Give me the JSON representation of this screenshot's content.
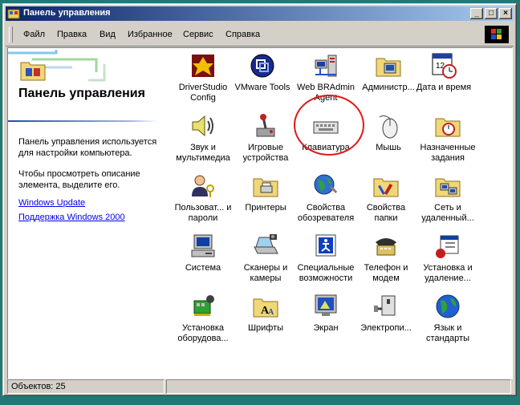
{
  "window": {
    "title": "Панель управления"
  },
  "menu": [
    "Файл",
    "Правка",
    "Вид",
    "Избранное",
    "Сервис",
    "Справка"
  ],
  "sidebar": {
    "heading": "Панель управления",
    "desc1": "Панель управления используется для настройки компьютера.",
    "desc2": "Чтобы просмотреть описание элемента, выделите его.",
    "links": [
      "Windows Update",
      "Поддержка Windows 2000"
    ]
  },
  "icons": [
    {
      "label": "DriverStudio Config",
      "icon": "driverstudio-icon"
    },
    {
      "label": "VMware Tools",
      "icon": "vmware-icon"
    },
    {
      "label": "Web BRAdmin Agent",
      "icon": "network-agent-icon"
    },
    {
      "label": "Админиcтр...",
      "icon": "admin-tools-icon"
    },
    {
      "label": "Дата и время",
      "icon": "calendar-clock-icon"
    },
    {
      "label": "Звук и мультимедиа",
      "icon": "speaker-icon"
    },
    {
      "label": "Игровые устройства",
      "icon": "joystick-icon"
    },
    {
      "label": "Клавиатура",
      "icon": "keyboard-icon"
    },
    {
      "label": "Мышь",
      "icon": "mouse-icon"
    },
    {
      "label": "Назначенные задания",
      "icon": "scheduled-tasks-icon"
    },
    {
      "label": "Пользоват... и пароли",
      "icon": "users-icon"
    },
    {
      "label": "Принтеры",
      "icon": "printer-folder-icon"
    },
    {
      "label": "Свойства обозревателя",
      "icon": "globe-tools-icon"
    },
    {
      "label": "Свойства папки",
      "icon": "folder-options-icon"
    },
    {
      "label": "Сеть и удаленный...",
      "icon": "network-folder-icon"
    },
    {
      "label": "Система",
      "icon": "computer-icon"
    },
    {
      "label": "Сканеры и камеры",
      "icon": "scanner-icon"
    },
    {
      "label": "Специальные возможности",
      "icon": "accessibility-icon"
    },
    {
      "label": "Телефон и модем",
      "icon": "telephone-icon"
    },
    {
      "label": "Установка и удаление...",
      "icon": "add-remove-icon"
    },
    {
      "label": "Установка оборудова...",
      "icon": "add-hardware-icon"
    },
    {
      "label": "Шрифты",
      "icon": "fonts-folder-icon"
    },
    {
      "label": "Экран",
      "icon": "display-icon"
    },
    {
      "label": "Электропи...",
      "icon": "power-icon"
    },
    {
      "label": "Язык и стандарты",
      "icon": "regional-globe-icon"
    }
  ],
  "status": {
    "text": "Объектов: 25"
  },
  "colors": {
    "desktop": "#1f7a76",
    "titlebar": "#0a246a",
    "highlight": "#e01818",
    "link": "#0000ee"
  }
}
